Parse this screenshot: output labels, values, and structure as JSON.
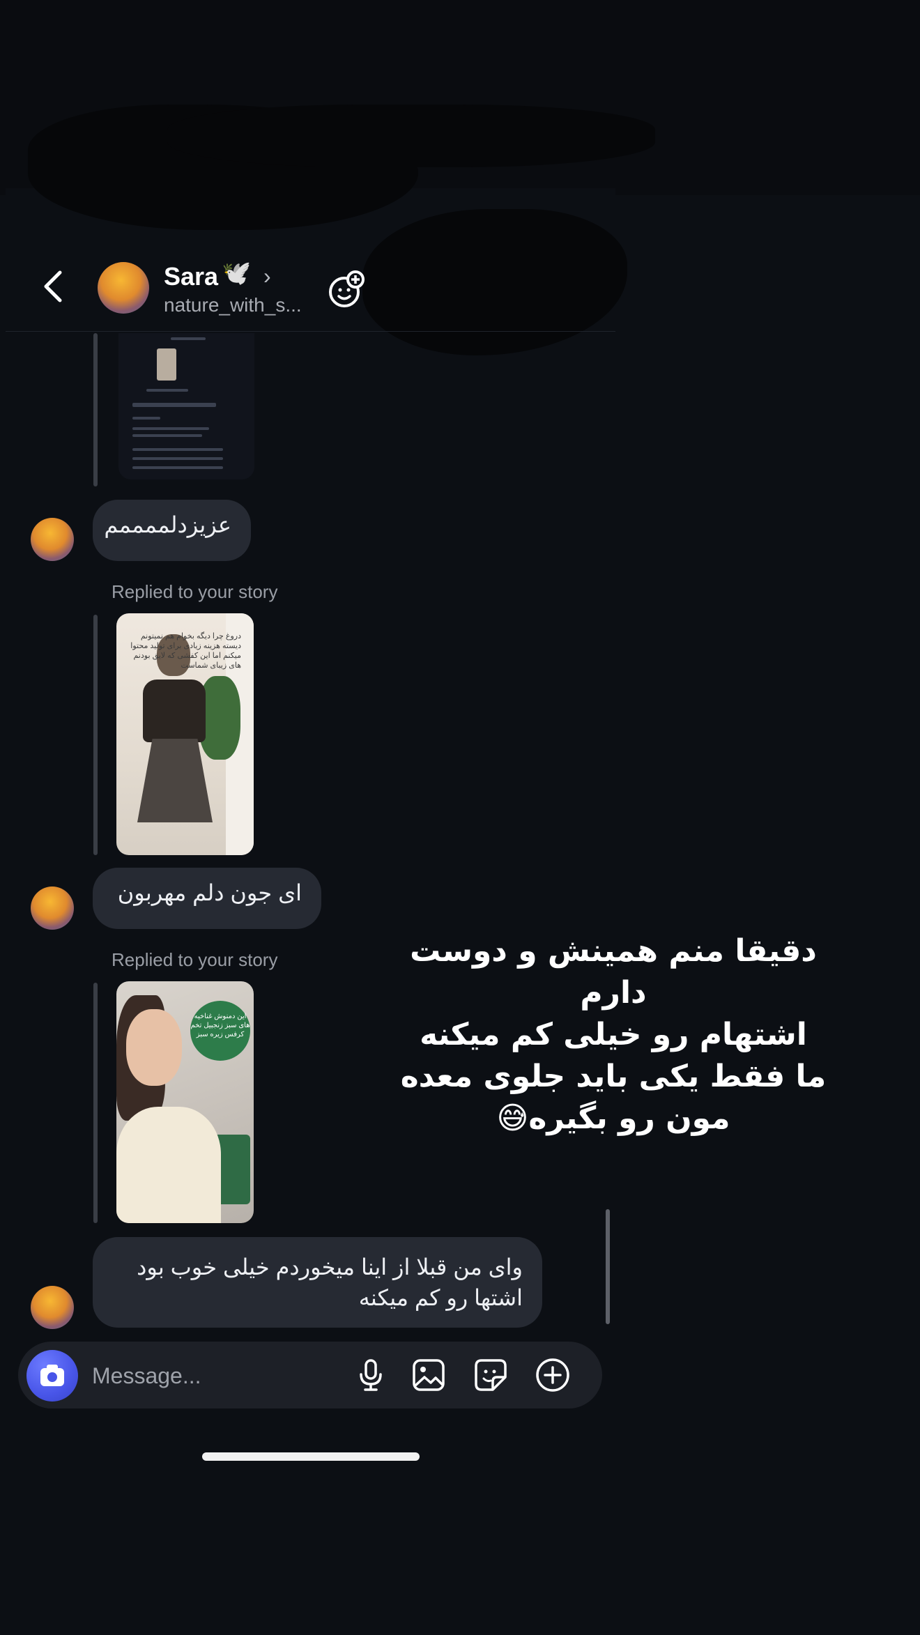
{
  "header": {
    "name": "Sara",
    "name_emoji": "🕊️",
    "username": "nature_with_s..."
  },
  "messages": [
    {
      "text": "عزیزدلممممم"
    },
    {
      "replied_label": "Replied to your story"
    },
    {
      "text": "ای جون دلم مهربون"
    },
    {
      "replied_label": "Replied to your story"
    },
    {
      "text_line1": "وای من قبلا از اینا میخوردم خیلی خوب بود",
      "text_line2": "اشتها رو کم میکنه"
    }
  ],
  "story_captions": {
    "story2": "دروغ چرا دیگه بخوام هم نمیتونم دیسته هزینه زیادی برای تولید محتوا میکنم اما این کفشی که لایق بودنم های زیبای شماست",
    "story3": "این دمنوش غناخیه های سبز زنجبیل تخم کرفس زیره سبز"
  },
  "composer": {
    "placeholder": "Message..."
  },
  "overlay": {
    "line1": "دقیقا منم همینش و دوست",
    "line2": "دارم",
    "line3": "اشتهام رو خیلی کم میکنه",
    "line4": "ما فقط یکی باید جلوی معده",
    "line5": "مون رو بگیره😅"
  },
  "colors": {
    "background": "#0c0f14",
    "bubble": "#262a33",
    "camera_button": "#4855e8"
  },
  "icons": [
    "back-icon",
    "chevron-right-icon",
    "add-emoji-icon",
    "camera-icon",
    "microphone-icon",
    "gallery-icon",
    "sticker-icon",
    "plus-circle-icon"
  ]
}
